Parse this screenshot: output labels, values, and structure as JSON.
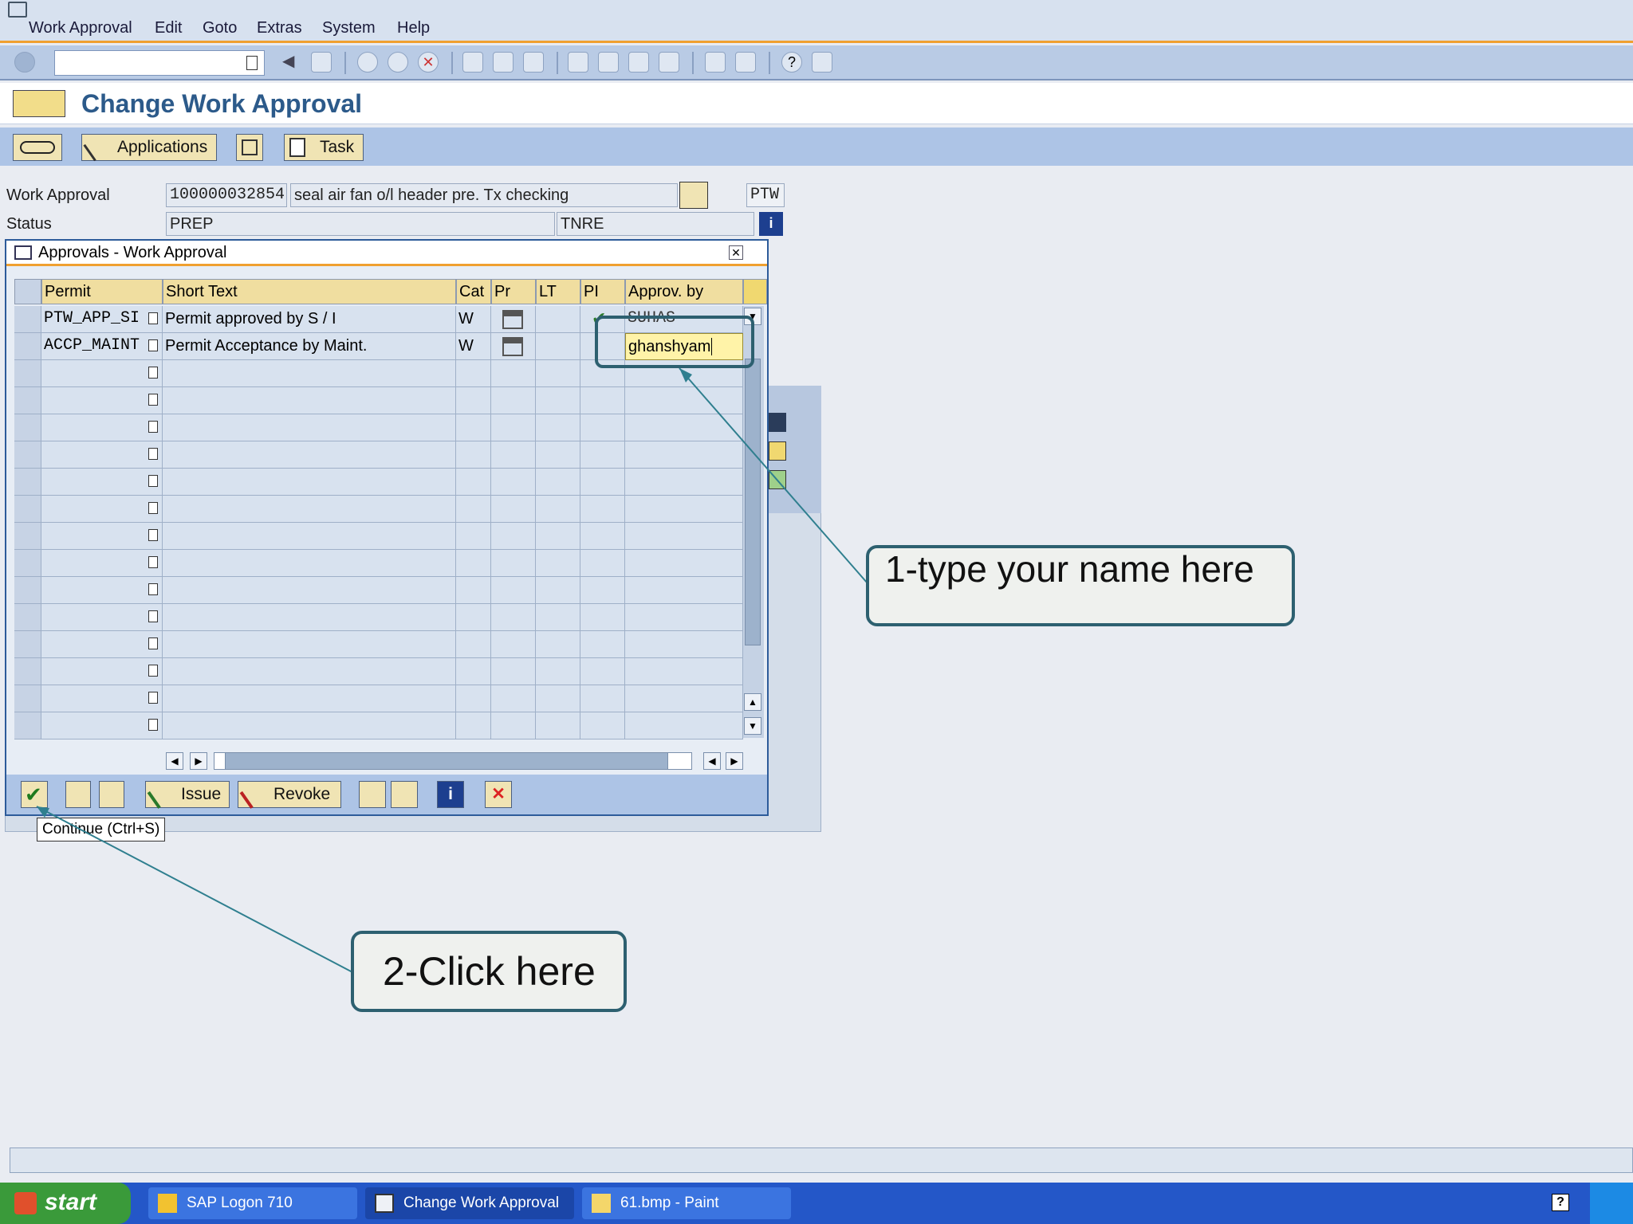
{
  "menu": {
    "items": [
      "Work Approval",
      "Edit",
      "Goto",
      "Extras",
      "System",
      "Help"
    ]
  },
  "title": "Change Work Approval",
  "app_toolbar": {
    "applications_label": "Applications",
    "task_label": "Task"
  },
  "header": {
    "work_approval_label": "Work Approval",
    "work_approval_number": "100000032854",
    "work_approval_text": "seal air fan o/l header pre. Tx checking",
    "type_code": "PTW",
    "status_label": "Status",
    "status_value": "PREP",
    "status_user": "TNRE"
  },
  "popup": {
    "title": "Approvals - Work Approval",
    "columns": [
      "Permit",
      "Short Text",
      "Cat",
      "Pr",
      "LT",
      "PI",
      "Approv. by"
    ],
    "rows": [
      {
        "permit": "PTW_APP_SI",
        "short_text": "Permit approved by S / I",
        "cat": "W",
        "approved_by": "SUHAS"
      },
      {
        "permit": "ACCP_MAINT",
        "short_text": "Permit Acceptance by Maint.",
        "cat": "W",
        "approved_by": "ghanshyam"
      }
    ],
    "buttons": {
      "issue": "Issue",
      "revoke": "Revoke"
    },
    "tooltip": "Continue   (Ctrl+S)"
  },
  "callouts": {
    "one": "1-type your name here",
    "two": "2-Click here"
  },
  "taskbar": {
    "start": "start",
    "tasks": [
      "SAP Logon 710",
      "Change Work Approval",
      "61.bmp - Paint"
    ]
  },
  "icons": [
    "enter-icon",
    "save-icon",
    "back-icon",
    "exit-icon",
    "cancel-icon",
    "print-icon",
    "find-icon",
    "help-icon",
    "display-icon",
    "check-icon",
    "close-icon"
  ],
  "colors": {
    "accent_orange": "#f0a030",
    "title_blue": "#2c5a8a",
    "callout_border": "#2d6070",
    "header_yellow": "#f0dea0"
  }
}
